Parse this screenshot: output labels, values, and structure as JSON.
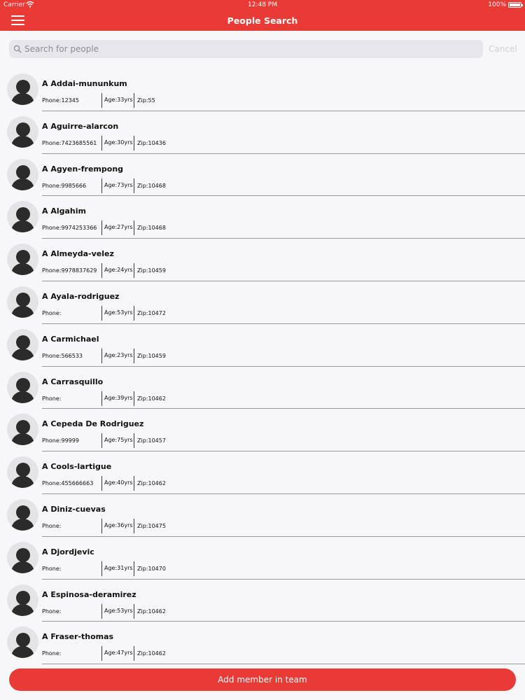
{
  "status_bar": {
    "carrier": "Carrier",
    "time": "12:48 PM",
    "battery": "100%"
  },
  "nav": {
    "title": "People Search"
  },
  "search": {
    "placeholder": "Search for people",
    "value": "",
    "cancel_label": "Cancel"
  },
  "colors": {
    "brand_red": "#e93a35",
    "background": "#f7f7f9"
  },
  "icons": {
    "menu": "hamburger-menu-icon",
    "search": "search-icon",
    "avatar": "person-silhouette-icon",
    "wifi": "wifi-icon",
    "battery": "battery-icon"
  },
  "people": [
    {
      "name": "A Addai-mununkum",
      "phone": "Phone:12345",
      "age": "Age:33yrs",
      "zip": "Zip:55"
    },
    {
      "name": "A Aguirre-alarcon",
      "phone": "Phone:7423685561",
      "age": "Age:30yrs",
      "zip": "Zip:10436"
    },
    {
      "name": "A Agyen-frempong",
      "phone": "Phone:9985666",
      "age": "Age:73yrs",
      "zip": "Zip:10468"
    },
    {
      "name": "A Algahim",
      "phone": "Phone:9974253366",
      "age": "Age:27yrs",
      "zip": "Zip:10468"
    },
    {
      "name": "A Almeyda-velez",
      "phone": "Phone:9978837629",
      "age": "Age:24yrs",
      "zip": "Zip:10459"
    },
    {
      "name": "A Ayala-rodriguez",
      "phone": "Phone:",
      "age": "Age:53yrs",
      "zip": "Zip:10472"
    },
    {
      "name": "A Carmichael",
      "phone": "Phone:566533",
      "age": "Age:23yrs",
      "zip": "Zip:10459"
    },
    {
      "name": "A Carrasquillo",
      "phone": "Phone:",
      "age": "Age:39yrs",
      "zip": "Zip:10462"
    },
    {
      "name": "A Cepeda De Rodriguez",
      "phone": "Phone:99999",
      "age": "Age:75yrs",
      "zip": "Zip:10457"
    },
    {
      "name": "A Cools-lartigue",
      "phone": "Phone:455666663",
      "age": "Age:40yrs",
      "zip": "Zip:10462"
    },
    {
      "name": "A Diniz-cuevas",
      "phone": "Phone:",
      "age": "Age:36yrs",
      "zip": "Zip:10475"
    },
    {
      "name": "A Djordjevic",
      "phone": "Phone:",
      "age": "Age:31yrs",
      "zip": "Zip:10470"
    },
    {
      "name": "A Espinosa-deramirez",
      "phone": "Phone:",
      "age": "Age:53yrs",
      "zip": "Zip:10462"
    },
    {
      "name": "A Fraser-thomas",
      "phone": "Phone:",
      "age": "Age:47yrs",
      "zip": "Zip:10462"
    }
  ],
  "footer": {
    "add_member_label": "Add member in team"
  }
}
